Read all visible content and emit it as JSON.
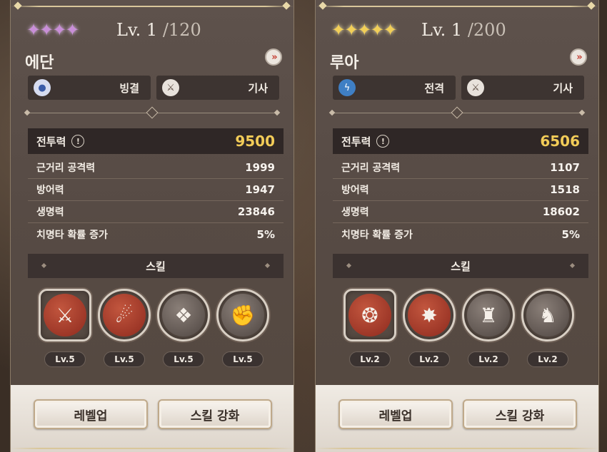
{
  "cards": [
    {
      "stars": [
        "✦",
        "✦",
        "✦",
        "✦"
      ],
      "level_label": "Lv. 1",
      "level_max": "/120",
      "name": "에단",
      "element_label": "빙결",
      "class_label": "기사",
      "power_label": "전투력",
      "power_value": "9500",
      "stats": [
        {
          "label": "근거리 공격력",
          "value": "1999"
        },
        {
          "label": "방어력",
          "value": "1947"
        },
        {
          "label": "생명력",
          "value": "23846"
        },
        {
          "label": "치명타 확률 증가",
          "value": "5%"
        }
      ],
      "skills_title": "스킬",
      "skills": [
        {
          "icon": "⚔",
          "level": "Lv.5"
        },
        {
          "icon": "☄",
          "level": "Lv.5"
        },
        {
          "icon": "❖",
          "level": "Lv.5"
        },
        {
          "icon": "✊",
          "level": "Lv.5"
        }
      ],
      "levelup_label": "레벨업",
      "skill_upgrade_label": "스킬 강화"
    },
    {
      "stars": [
        "✦",
        "✦",
        "✦",
        "✦",
        "✦"
      ],
      "level_label": "Lv. 1",
      "level_max": "/200",
      "name": "루아",
      "element_label": "전격",
      "class_label": "기사",
      "power_label": "전투력",
      "power_value": "6506",
      "stats": [
        {
          "label": "근거리 공격력",
          "value": "1107"
        },
        {
          "label": "방어력",
          "value": "1518"
        },
        {
          "label": "생명력",
          "value": "18602"
        },
        {
          "label": "치명타 확률 증가",
          "value": "5%"
        }
      ],
      "skills_title": "스킬",
      "skills": [
        {
          "icon": "❂",
          "level": "Lv.2"
        },
        {
          "icon": "✸",
          "level": "Lv.2"
        },
        {
          "icon": "♜",
          "level": "Lv.2"
        },
        {
          "icon": "♞",
          "level": "Lv.2"
        }
      ],
      "levelup_label": "레벨업",
      "skill_upgrade_label": "스킬 강화"
    }
  ],
  "icons": {
    "water": "💧",
    "electric": "ϟ",
    "knight": "⚔",
    "info": "!",
    "arrow": "»"
  },
  "colors": {
    "power_value": "#f2cc58",
    "skill_red": "#a83a28",
    "star_pink": "#c98fd8",
    "star_gold": "#f2cf58"
  }
}
